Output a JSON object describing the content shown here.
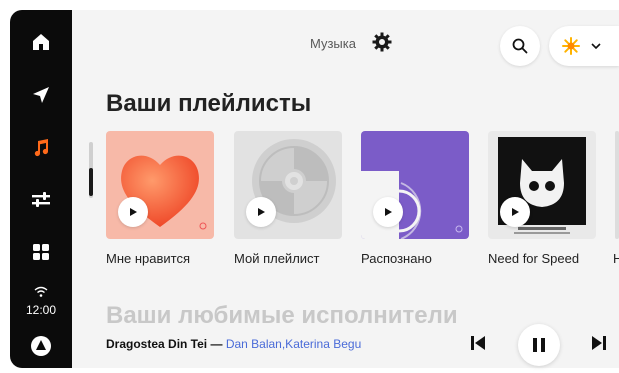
{
  "header": {
    "title": "Музыка"
  },
  "sidebar": {
    "time": "12:00"
  },
  "sections": {
    "playlists_title": "Ваши плейлисты",
    "artists_title": "Ваши любимые исполнители"
  },
  "playlists": [
    {
      "label": "Мне нравится"
    },
    {
      "label": "Мой плейлист"
    },
    {
      "label": "Распознано"
    },
    {
      "label": "Need for Speed"
    },
    {
      "label": "Н"
    }
  ],
  "now_playing": {
    "song": "Dragostea Din Tei",
    "separator": " — ",
    "artist": "Dan Balan,Katerina Begu"
  },
  "colors": {
    "accent": "#ff6a1a",
    "sidebar_bg": "#0b0b0b",
    "main_bg": "#f4f4f4",
    "artist_link": "#4a6bd8",
    "tile_purple": "#7b5cc8"
  },
  "icons": {
    "sidebar": [
      "home-icon",
      "navigation-arrow-icon",
      "music-note-icon",
      "sliders-icon",
      "apps-grid-icon",
      "wifi-icon",
      "alice-icon"
    ],
    "header": [
      "gear-icon",
      "search-icon",
      "avatar-icon",
      "chevron-down-icon"
    ],
    "player": [
      "previous-track-icon",
      "pause-icon",
      "next-track-icon"
    ]
  }
}
